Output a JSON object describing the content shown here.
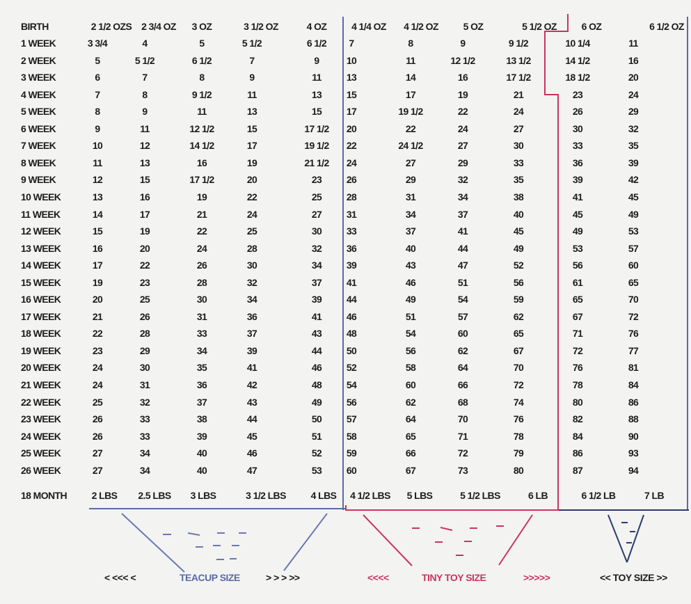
{
  "header": {
    "label": "BIRTH",
    "values": [
      "2 1/2 OZS",
      "2 3/4 OZ",
      "3 OZ",
      "3 1/2 OZ",
      "4 OZ",
      "4 1/4 OZ",
      "4 1/2 OZ",
      "5 OZ",
      "5 1/2 OZ",
      "6 OZ",
      "6 1/2 OZ"
    ]
  },
  "rows": [
    {
      "label": "1 WEEK",
      "values": [
        "3 3/4",
        "4",
        "5",
        "5 1/2",
        "6 1/2",
        "7",
        "8",
        "9",
        "9 1/2",
        "10 1/4",
        "11"
      ]
    },
    {
      "label": "2 WEEK",
      "values": [
        "5",
        "5 1/2",
        "6 1/2",
        "7",
        "9",
        "10",
        "11",
        "12 1/2",
        "13 1/2",
        "14 1/2",
        "16"
      ]
    },
    {
      "label": "3 WEEK",
      "values": [
        "6",
        "7",
        "8",
        "9",
        "11",
        "13",
        "14",
        "16",
        "17 1/2",
        "18 1/2",
        "20"
      ]
    },
    {
      "label": "4 WEEK",
      "values": [
        "7",
        "8",
        "9 1/2",
        "11",
        "13",
        "15",
        "17",
        "19",
        "21",
        "23",
        "24"
      ]
    },
    {
      "label": "5 WEEK",
      "values": [
        "8",
        "9",
        "11",
        "13",
        "15",
        "17",
        "19 1/2",
        "22",
        "24",
        "26",
        "29"
      ]
    },
    {
      "label": "6 WEEK",
      "values": [
        "9",
        "11",
        "12 1/2",
        "15",
        "17 1/2",
        "20",
        "22",
        "24",
        "27",
        "30",
        "32"
      ]
    },
    {
      "label": "7 WEEK",
      "values": [
        "10",
        "12",
        "14 1/2",
        "17",
        "19 1/2",
        "22",
        "24 1/2",
        "27",
        "30",
        "33",
        "35"
      ]
    },
    {
      "label": "8 WEEK",
      "values": [
        "11",
        "13",
        "16",
        "19",
        "21 1/2",
        "24",
        "27",
        "29",
        "33",
        "36",
        "39"
      ]
    },
    {
      "label": "9 WEEK",
      "values": [
        "12",
        "15",
        "17 1/2",
        "20",
        "23",
        "26",
        "29",
        "32",
        "35",
        "39",
        "42"
      ]
    },
    {
      "label": "10 WEEK",
      "values": [
        "13",
        "16",
        "19",
        "22",
        "25",
        "28",
        "31",
        "34",
        "38",
        "41",
        "45"
      ]
    },
    {
      "label": "11 WEEK",
      "values": [
        "14",
        "17",
        "21",
        "24",
        "27",
        "31",
        "34",
        "37",
        "40",
        "45",
        "49"
      ]
    },
    {
      "label": "12 WEEK",
      "values": [
        "15",
        "19",
        "22",
        "25",
        "30",
        "33",
        "37",
        "41",
        "45",
        "49",
        "53"
      ]
    },
    {
      "label": "13 WEEK",
      "values": [
        "16",
        "20",
        "24",
        "28",
        "32",
        "36",
        "40",
        "44",
        "49",
        "53",
        "57"
      ]
    },
    {
      "label": "14 WEEK",
      "values": [
        "17",
        "22",
        "26",
        "30",
        "34",
        "39",
        "43",
        "47",
        "52",
        "56",
        "60"
      ]
    },
    {
      "label": "15 WEEK",
      "values": [
        "19",
        "23",
        "28",
        "32",
        "37",
        "41",
        "46",
        "51",
        "56",
        "61",
        "65"
      ]
    },
    {
      "label": "16 WEEK",
      "values": [
        "20",
        "25",
        "30",
        "34",
        "39",
        "44",
        "49",
        "54",
        "59",
        "65",
        "70"
      ]
    },
    {
      "label": "17 WEEK",
      "values": [
        "21",
        "26",
        "31",
        "36",
        "41",
        "46",
        "51",
        "57",
        "62",
        "67",
        "72"
      ]
    },
    {
      "label": "18 WEEK",
      "values": [
        "22",
        "28",
        "33",
        "37",
        "43",
        "48",
        "54",
        "60",
        "65",
        "71",
        "76"
      ]
    },
    {
      "label": "19 WEEK",
      "values": [
        "23",
        "29",
        "34",
        "39",
        "44",
        "50",
        "56",
        "62",
        "67",
        "72",
        "77"
      ]
    },
    {
      "label": "20 WEEK",
      "values": [
        "24",
        "30",
        "35",
        "41",
        "46",
        "52",
        "58",
        "64",
        "70",
        "76",
        "81"
      ]
    },
    {
      "label": "21 WEEK",
      "values": [
        "24",
        "31",
        "36",
        "42",
        "48",
        "54",
        "60",
        "66",
        "72",
        "78",
        "84"
      ]
    },
    {
      "label": "22 WEEK",
      "values": [
        "25",
        "32",
        "37",
        "43",
        "49",
        "56",
        "62",
        "68",
        "74",
        "80",
        "86"
      ]
    },
    {
      "label": "23 WEEK",
      "values": [
        "26",
        "33",
        "38",
        "44",
        "50",
        "57",
        "64",
        "70",
        "76",
        "82",
        "88"
      ]
    },
    {
      "label": "24 WEEK",
      "values": [
        "26",
        "33",
        "39",
        "45",
        "51",
        "58",
        "65",
        "71",
        "78",
        "84",
        "90"
      ]
    },
    {
      "label": "25 WEEK",
      "values": [
        "27",
        "34",
        "40",
        "46",
        "52",
        "59",
        "66",
        "72",
        "79",
        "86",
        "93"
      ]
    },
    {
      "label": "26 WEEK",
      "values": [
        "27",
        "34",
        "40",
        "47",
        "53",
        "60",
        "67",
        "73",
        "80",
        "87",
        "94"
      ]
    }
  ],
  "final": {
    "label": "18 MONTH",
    "values": [
      "2 LBS",
      "2.5 LBS",
      "3 LBS",
      "3 1/2 LBS",
      "4 LBS",
      "4 1/2 LBS",
      "5 LBS",
      "5 1/2 LBS",
      "6 LB",
      "6 1/2 LB",
      "7 LB"
    ]
  },
  "footer": {
    "teacup": {
      "left": "< <<< <",
      "label": "TEACUP SIZE",
      "right": "> > > >>"
    },
    "tiny_toy": {
      "left": "<<<<",
      "label": "TINY TOY SIZE",
      "right": ">>>>>"
    },
    "toy": {
      "label": "<< TOY SIZE >>"
    }
  },
  "colors": {
    "teacup": "#5a6aa8",
    "tiny_toy": "#c8345f",
    "toy": "#2a3a6a",
    "text": "#1c1c1c"
  }
}
